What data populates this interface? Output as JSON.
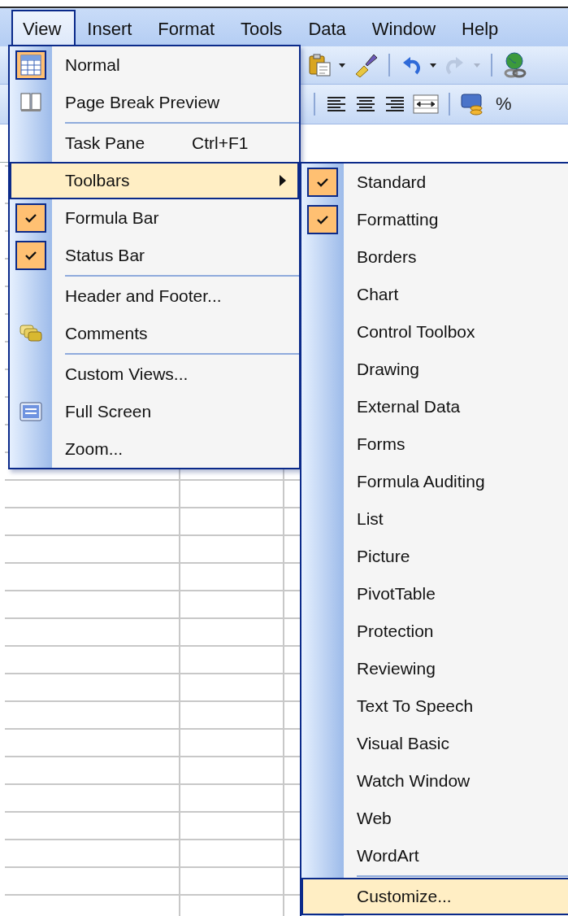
{
  "menu_bar": {
    "items": [
      {
        "label": "View",
        "selected": true
      },
      {
        "label": "Insert",
        "selected": false
      },
      {
        "label": "Format",
        "selected": false
      },
      {
        "label": "Tools",
        "selected": false
      },
      {
        "label": "Data",
        "selected": false
      },
      {
        "label": "Window",
        "selected": false
      },
      {
        "label": "Help",
        "selected": false
      }
    ]
  },
  "formatting_toolbar": {
    "percent_button": "%"
  },
  "view_menu": {
    "items": [
      {
        "kind": "sheet",
        "label": "Normal",
        "checked": true,
        "selected": false
      },
      {
        "kind": "pages",
        "label": "Page Break Preview",
        "checked": false,
        "selected": false
      },
      {
        "kind": "separator"
      },
      {
        "kind": "item",
        "label": "Task Pane",
        "shortcut": "Ctrl+F1",
        "checked": false,
        "selected": false
      },
      {
        "kind": "submenu",
        "label": "Toolbars",
        "checked": false,
        "selected": true
      },
      {
        "kind": "item",
        "label": "Formula Bar",
        "checked": true,
        "selected": false
      },
      {
        "kind": "item",
        "label": "Status Bar",
        "checked": true,
        "selected": false
      },
      {
        "kind": "separator"
      },
      {
        "kind": "item",
        "label": "Header and Footer...",
        "checked": false,
        "selected": false
      },
      {
        "kind": "comments",
        "label": "Comments",
        "checked": false,
        "selected": false
      },
      {
        "kind": "separator"
      },
      {
        "kind": "item",
        "label": "Custom Views...",
        "checked": false,
        "selected": false
      },
      {
        "kind": "screen",
        "label": "Full Screen",
        "checked": false,
        "selected": false
      },
      {
        "kind": "item",
        "label": "Zoom...",
        "checked": false,
        "selected": false
      }
    ]
  },
  "toolbars_submenu": {
    "items": [
      {
        "kind": "item",
        "label": "Standard",
        "checked": true,
        "selected": false
      },
      {
        "kind": "item",
        "label": "Formatting",
        "checked": true,
        "selected": false
      },
      {
        "kind": "item",
        "label": "Borders",
        "checked": false,
        "selected": false
      },
      {
        "kind": "item",
        "label": "Chart",
        "checked": false,
        "selected": false
      },
      {
        "kind": "item",
        "label": "Control Toolbox",
        "checked": false,
        "selected": false
      },
      {
        "kind": "item",
        "label": "Drawing",
        "checked": false,
        "selected": false
      },
      {
        "kind": "item",
        "label": "External Data",
        "checked": false,
        "selected": false
      },
      {
        "kind": "item",
        "label": "Forms",
        "checked": false,
        "selected": false
      },
      {
        "kind": "item",
        "label": "Formula Auditing",
        "checked": false,
        "selected": false
      },
      {
        "kind": "item",
        "label": "List",
        "checked": false,
        "selected": false
      },
      {
        "kind": "item",
        "label": "Picture",
        "checked": false,
        "selected": false
      },
      {
        "kind": "item",
        "label": "PivotTable",
        "checked": false,
        "selected": false
      },
      {
        "kind": "item",
        "label": "Protection",
        "checked": false,
        "selected": false
      },
      {
        "kind": "item",
        "label": "Reviewing",
        "checked": false,
        "selected": false
      },
      {
        "kind": "item",
        "label": "Text To Speech",
        "checked": false,
        "selected": false
      },
      {
        "kind": "item",
        "label": "Visual Basic",
        "checked": false,
        "selected": false
      },
      {
        "kind": "item",
        "label": "Watch Window",
        "checked": false,
        "selected": false
      },
      {
        "kind": "item",
        "label": "Web",
        "checked": false,
        "selected": false
      },
      {
        "kind": "item",
        "label": "WordArt",
        "checked": false,
        "selected": false
      },
      {
        "kind": "separator"
      },
      {
        "kind": "item",
        "label": "Customize...",
        "checked": false,
        "selected": true
      }
    ]
  }
}
